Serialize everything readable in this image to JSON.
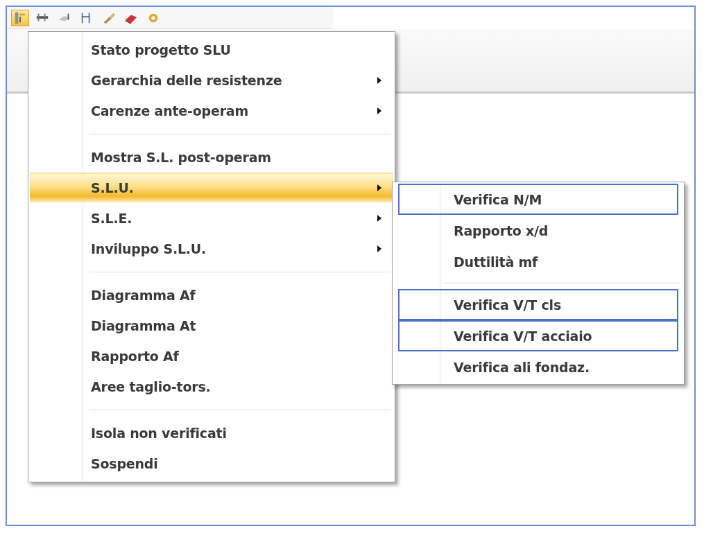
{
  "toolbar": {
    "buttons": [
      {
        "kind": "column",
        "selected": true
      },
      {
        "kind": "beam",
        "selected": false
      },
      {
        "kind": "slab",
        "selected": false
      },
      {
        "kind": "frame",
        "selected": false
      },
      {
        "kind": "brush",
        "selected": false
      },
      {
        "kind": "eraser",
        "selected": false
      },
      {
        "kind": "gear",
        "selected": false
      }
    ]
  },
  "context_menu": {
    "groups": [
      [
        {
          "label": "Stato progetto SLU",
          "submenu": false,
          "selected": false
        },
        {
          "label": "Gerarchia delle resistenze",
          "submenu": true,
          "selected": false
        },
        {
          "label": "Carenze ante-operam",
          "submenu": true,
          "selected": false
        }
      ],
      [
        {
          "label": "Mostra S.L. post-operam",
          "submenu": false,
          "selected": false
        },
        {
          "label": "S.L.U.",
          "submenu": true,
          "selected": true
        },
        {
          "label": "S.L.E.",
          "submenu": true,
          "selected": false
        },
        {
          "label": "Inviluppo S.L.U.",
          "submenu": true,
          "selected": false
        }
      ],
      [
        {
          "label": "Diagramma Af",
          "submenu": false,
          "selected": false
        },
        {
          "label": "Diagramma At",
          "submenu": false,
          "selected": false
        },
        {
          "label": "Rapporto Af",
          "submenu": false,
          "selected": false
        },
        {
          "label": "Aree taglio-tors.",
          "submenu": false,
          "selected": false
        }
      ],
      [
        {
          "label": "Isola non verificati",
          "submenu": false,
          "selected": false
        },
        {
          "label": "Sospendi",
          "submenu": false,
          "selected": false
        }
      ]
    ]
  },
  "submenu": {
    "groups": [
      [
        {
          "label": "Verifica N/M",
          "outlined": true
        },
        {
          "label": "Rapporto x/d",
          "outlined": false
        },
        {
          "label": "Duttilità mf",
          "outlined": false
        }
      ],
      [
        {
          "label": "Verifica V/T cls",
          "outlined": true
        },
        {
          "label": "Verifica V/T acciaio",
          "outlined": true
        },
        {
          "label": "Verifica ali fondaz.",
          "outlined": false
        }
      ]
    ]
  }
}
